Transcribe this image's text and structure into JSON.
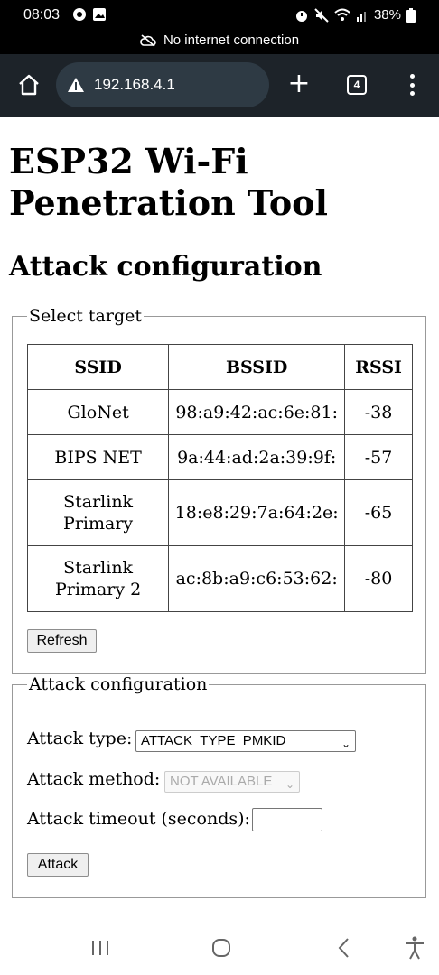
{
  "status_bar": {
    "time": "08:03",
    "battery": "38%",
    "notice": "No internet connection"
  },
  "browser": {
    "url": "192.168.4.1",
    "tab_count": "4",
    "new_tab": "+"
  },
  "page": {
    "title": "ESP32 Wi-Fi Penetration Tool",
    "section_title": "Attack configuration"
  },
  "target": {
    "legend": "Select target",
    "columns": [
      "SSID",
      "BSSID",
      "RSSI"
    ],
    "rows": [
      {
        "ssid": "GloNet",
        "bssid": "98:a9:42:ac:6e:81:",
        "rssi": "-38"
      },
      {
        "ssid": "BIPS NET",
        "bssid": "9a:44:ad:2a:39:9f:",
        "rssi": "-57"
      },
      {
        "ssid": "Starlink Primary",
        "bssid": "18:e8:29:7a:64:2e:",
        "rssi": "-65"
      },
      {
        "ssid": "Starlink Primary 2",
        "bssid": "ac:8b:a9:c6:53:62:",
        "rssi": "-80"
      }
    ],
    "refresh_label": "Refresh"
  },
  "attack": {
    "legend": "Attack configuration",
    "type_label": "Attack type:",
    "type_value": "ATTACK_TYPE_PMKID",
    "method_label": "Attack method:",
    "method_value": "NOT AVAILABLE",
    "timeout_label": "Attack timeout (seconds):",
    "timeout_value": "",
    "attack_button": "Attack"
  },
  "colors": {
    "browser_bar": "#1d2329",
    "url_pill": "#2e3a44"
  }
}
